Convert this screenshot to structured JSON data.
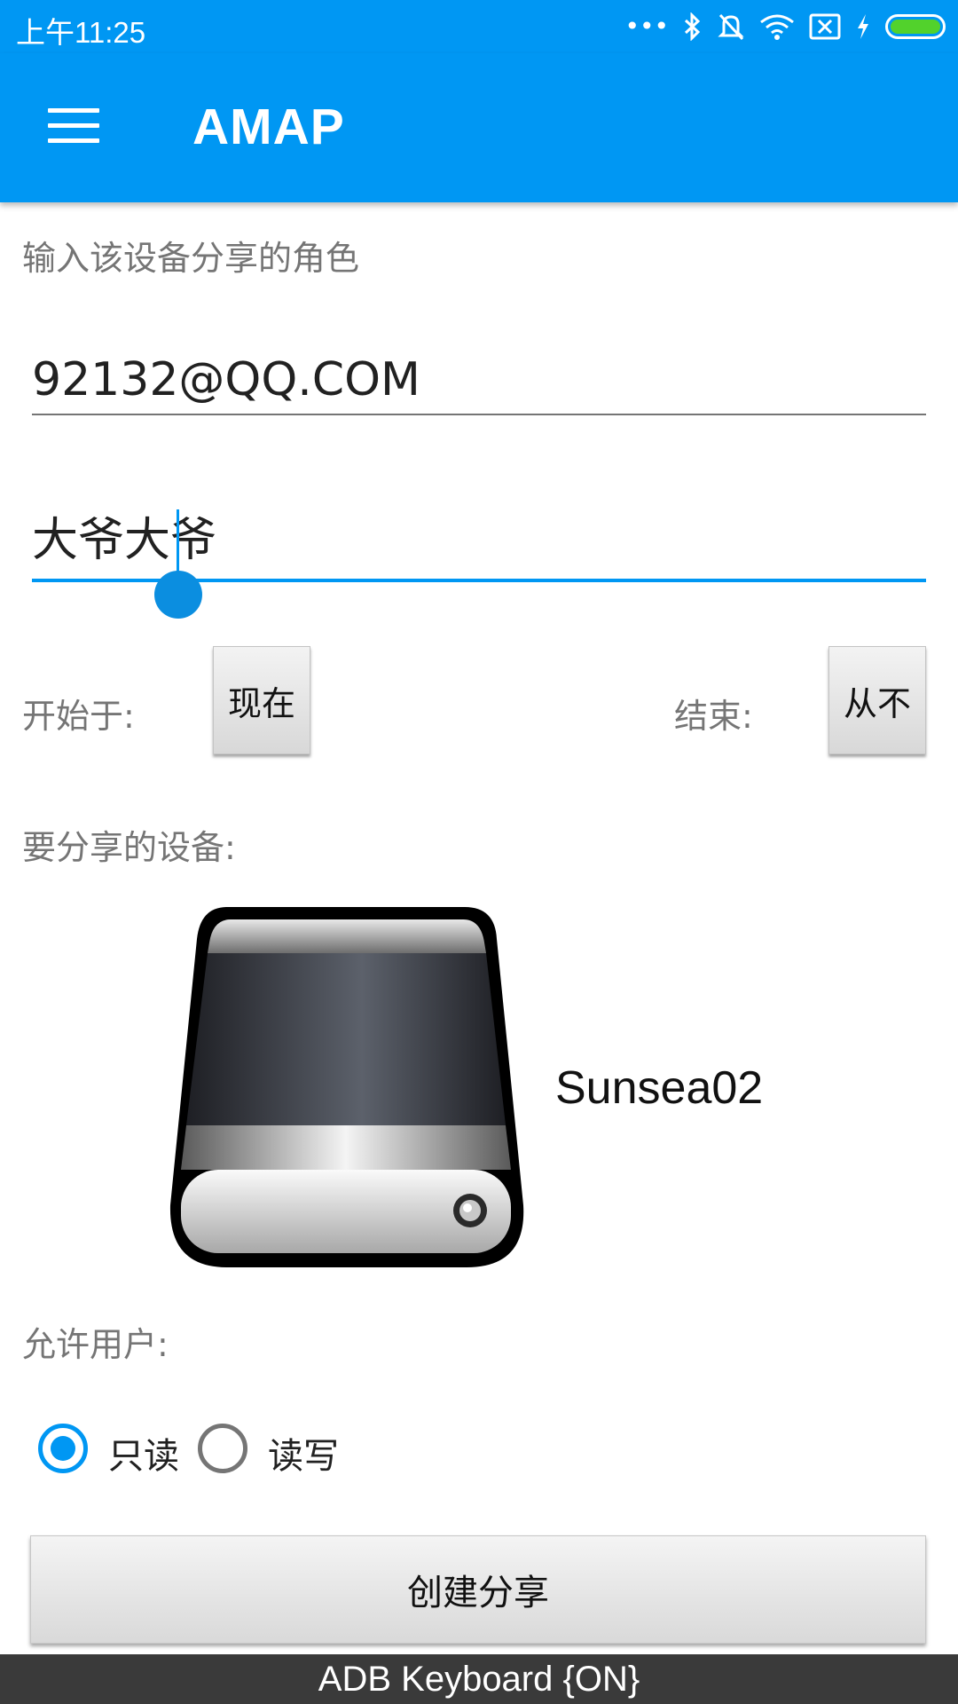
{
  "status_bar": {
    "time": "上午11:25",
    "icons": [
      "more-dots-icon",
      "bluetooth-icon",
      "bell-off-icon",
      "wifi-icon",
      "sim-off-icon",
      "charging-icon",
      "battery-icon"
    ]
  },
  "app_bar": {
    "title": "AMAP",
    "menu_icon": "hamburger-menu-icon",
    "color": "#0097f3"
  },
  "form": {
    "role_prompt": "输入该设备分享的角色",
    "email_value": "92132@QQ.COM",
    "name_value": "大爷大爷",
    "start_label": "开始于:",
    "start_button": "现在",
    "end_label": "结束:",
    "end_button": "从不",
    "device_section_label": "要分享的设备:",
    "device": {
      "icon": "hard-drive-icon",
      "name": "Sunsea02"
    },
    "permission_label": "允许用户:",
    "permissions": [
      {
        "label": "只读",
        "checked": true
      },
      {
        "label": "读写",
        "checked": false
      }
    ],
    "submit_button": "创建分享"
  },
  "keyboard_bar": {
    "text": "ADB Keyboard {ON}"
  }
}
